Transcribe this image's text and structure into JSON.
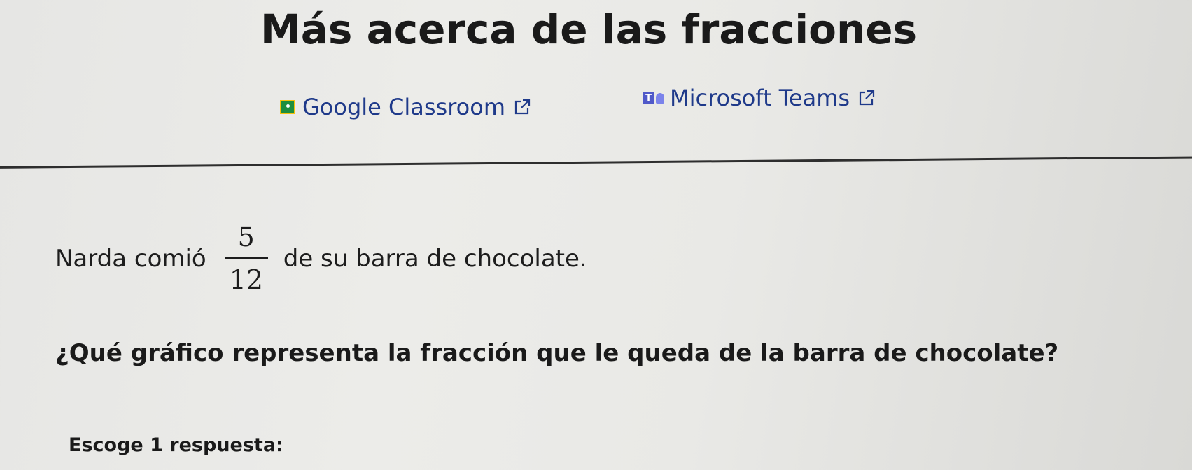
{
  "header": {
    "title": "Más acerca de las fracciones"
  },
  "share": {
    "google_label": "Google Classroom",
    "teams_label": "Microsoft Teams",
    "google_icon": "google-classroom-icon",
    "teams_icon": "microsoft-teams-icon",
    "external_icon": "external-link-icon",
    "link_color": "#1f3a8a"
  },
  "problem": {
    "statement_prefix": "Narda comió",
    "fraction": {
      "numerator": "5",
      "denominator": "12"
    },
    "statement_suffix": "de su barra de chocolate.",
    "question": "¿Qué gráfico representa la fracción que le queda de la barra de chocolate?",
    "instruction": "Escoge 1 respuesta:"
  }
}
